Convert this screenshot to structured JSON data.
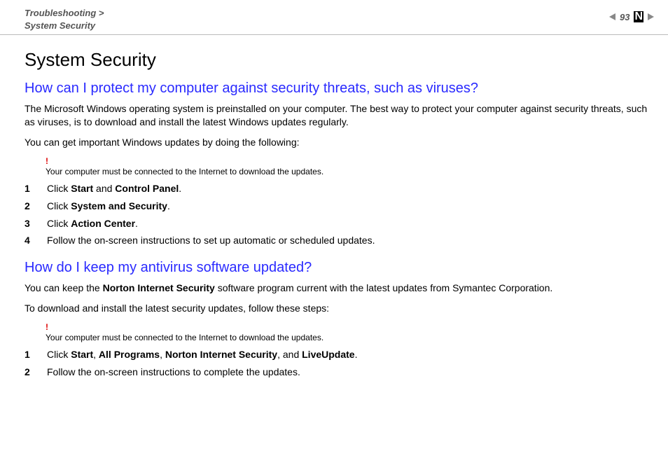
{
  "header": {
    "breadcrumb_line1": "Troubleshooting >",
    "breadcrumb_line2": "System Security",
    "page_number": "93"
  },
  "page": {
    "title": "System Security",
    "section1": {
      "heading": "How can I protect my computer against security threats, such as viruses?",
      "intro1": "The Microsoft Windows operating system is preinstalled on your computer. The best way to protect your computer against security threats, such as viruses, is to download and install the latest Windows updates regularly.",
      "intro2": "You can get important Windows updates by doing the following:",
      "warn_mark": "!",
      "warning": "Your computer must be connected to the Internet to download the updates.",
      "steps": [
        {
          "pre": "Click ",
          "b1": "Start",
          "mid": " and ",
          "b2": "Control Panel",
          "post": "."
        },
        {
          "pre": "Click ",
          "b1": "System and Security",
          "post": "."
        },
        {
          "pre": "Click ",
          "b1": "Action Center",
          "post": "."
        },
        {
          "plain": "Follow the on-screen instructions to set up automatic or scheduled updates."
        }
      ]
    },
    "section2": {
      "heading": "How do I keep my antivirus software updated?",
      "intro1_pre": "You can keep the ",
      "intro1_b": "Norton Internet Security",
      "intro1_post": " software program current with the latest updates from Symantec Corporation.",
      "intro2": "To download and install the latest security updates, follow these steps:",
      "warn_mark": "!",
      "warning": "Your computer must be connected to the Internet to download the updates.",
      "steps": [
        {
          "pre": "Click ",
          "b1": "Start",
          "m1": ", ",
          "b2": "All Programs",
          "m2": ", ",
          "b3": "Norton Internet Security",
          "m3": ", and ",
          "b4": "LiveUpdate",
          "post": "."
        },
        {
          "plain": "Follow the on-screen instructions to complete the updates."
        }
      ]
    }
  }
}
